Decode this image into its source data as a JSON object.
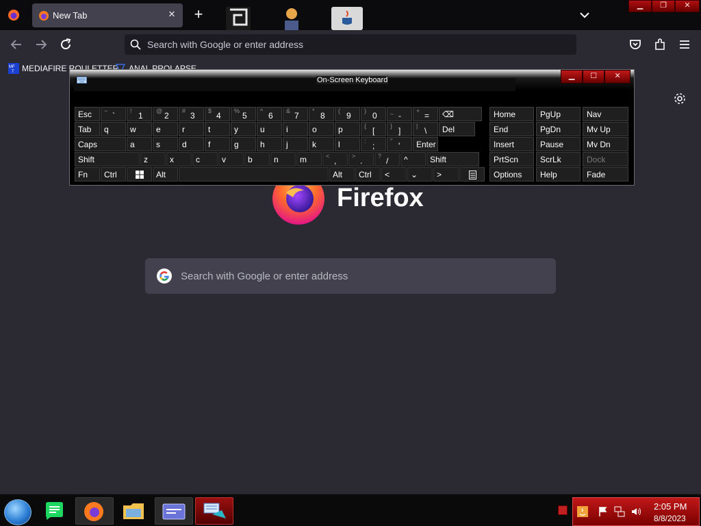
{
  "browser": {
    "tab": {
      "title": "New Tab",
      "close_glyph": "✕"
    },
    "new_tab_glyph": "+",
    "urlbar": {
      "placeholder": "Search with Google or enter address"
    },
    "bookmarks": [
      {
        "label": "MEDIAFIRE ROULETTER",
        "icon": "mediafire-icon"
      },
      {
        "label": "ANAL PROLAPSE",
        "icon": "bookmark-logo-icon"
      }
    ]
  },
  "newtab": {
    "wordmark": "Firefox",
    "search_placeholder": "Search with Google or enter address"
  },
  "osk": {
    "title": "On-Screen Keyboard",
    "rows": [
      [
        {
          "k": "esc",
          "label": "Esc"
        },
        {
          "k": "tilde",
          "shift": "~",
          "base": "`"
        },
        {
          "k": "1",
          "shift": "!",
          "base": "1"
        },
        {
          "k": "2",
          "shift": "@",
          "base": "2"
        },
        {
          "k": "3",
          "shift": "#",
          "base": "3"
        },
        {
          "k": "4",
          "shift": "$",
          "base": "4"
        },
        {
          "k": "5",
          "shift": "%",
          "base": "5"
        },
        {
          "k": "6",
          "shift": "^",
          "base": "6"
        },
        {
          "k": "7",
          "shift": "&",
          "base": "7"
        },
        {
          "k": "8",
          "shift": "*",
          "base": "8"
        },
        {
          "k": "9",
          "shift": "(",
          "base": "9"
        },
        {
          "k": "0",
          "shift": ")",
          "base": "0"
        },
        {
          "k": "minus",
          "shift": "_",
          "base": "-"
        },
        {
          "k": "equals",
          "shift": "+",
          "base": "="
        },
        {
          "k": "backspace",
          "label": "⌫"
        }
      ],
      [
        {
          "k": "tab",
          "label": "Tab"
        },
        {
          "k": "q",
          "label": "q"
        },
        {
          "k": "w",
          "label": "w"
        },
        {
          "k": "e",
          "label": "e"
        },
        {
          "k": "r",
          "label": "r"
        },
        {
          "k": "t",
          "label": "t"
        },
        {
          "k": "y",
          "label": "y"
        },
        {
          "k": "u",
          "label": "u"
        },
        {
          "k": "i",
          "label": "i"
        },
        {
          "k": "o",
          "label": "o"
        },
        {
          "k": "p",
          "label": "p"
        },
        {
          "k": "lbracket",
          "shift": "{",
          "base": "["
        },
        {
          "k": "rbracket",
          "shift": "}",
          "base": "]"
        },
        {
          "k": "backslash",
          "shift": "|",
          "base": "\\"
        },
        {
          "k": "del",
          "label": "Del"
        }
      ],
      [
        {
          "k": "caps",
          "label": "Caps"
        },
        {
          "k": "a",
          "label": "a"
        },
        {
          "k": "s",
          "label": "s"
        },
        {
          "k": "d",
          "label": "d"
        },
        {
          "k": "f",
          "label": "f"
        },
        {
          "k": "g",
          "label": "g"
        },
        {
          "k": "h",
          "label": "h"
        },
        {
          "k": "j",
          "label": "j"
        },
        {
          "k": "k",
          "label": "k"
        },
        {
          "k": "l",
          "label": "l"
        },
        {
          "k": "semicolon",
          "shift": ":",
          "base": ";"
        },
        {
          "k": "quote",
          "shift": "\"",
          "base": "'"
        },
        {
          "k": "enter",
          "label": "Enter"
        }
      ],
      [
        {
          "k": "lshift",
          "label": "Shift"
        },
        {
          "k": "z",
          "label": "z"
        },
        {
          "k": "x",
          "label": "x"
        },
        {
          "k": "c",
          "label": "c"
        },
        {
          "k": "v",
          "label": "v"
        },
        {
          "k": "b",
          "label": "b"
        },
        {
          "k": "n",
          "label": "n"
        },
        {
          "k": "m",
          "label": "m"
        },
        {
          "k": "comma",
          "shift": "<",
          "base": ","
        },
        {
          "k": "period",
          "shift": ">",
          "base": "."
        },
        {
          "k": "slash",
          "shift": "?",
          "base": "/"
        },
        {
          "k": "up",
          "label": "^"
        },
        {
          "k": "rshift",
          "label": "Shift"
        }
      ],
      [
        {
          "k": "fn",
          "label": "Fn"
        },
        {
          "k": "lctrl",
          "label": "Ctrl"
        },
        {
          "k": "win",
          "label": ""
        },
        {
          "k": "lalt",
          "label": "Alt"
        },
        {
          "k": "space",
          "label": ""
        },
        {
          "k": "ralt",
          "label": "Alt"
        },
        {
          "k": "rctrl",
          "label": "Ctrl"
        },
        {
          "k": "left",
          "label": "<"
        },
        {
          "k": "down",
          "label": "⌄"
        },
        {
          "k": "right",
          "label": ">"
        },
        {
          "k": "menu",
          "label": ""
        }
      ]
    ],
    "nav_keys": [
      [
        "Home",
        "PgUp",
        "Nav"
      ],
      [
        "End",
        "PgDn",
        "Mv Up"
      ],
      [
        "Insert",
        "Pause",
        "Mv Dn"
      ],
      [
        "PrtScn",
        "ScrLk",
        "Dock"
      ],
      [
        "Options",
        "Help",
        "Fade"
      ]
    ]
  },
  "taskbar": {
    "apps": [
      "start-orb",
      "notes-app",
      "firefox",
      "file-explorer",
      "card-app",
      "osk-app"
    ],
    "clock": {
      "time": "2:05 PM",
      "date": "8/8/2023"
    }
  }
}
